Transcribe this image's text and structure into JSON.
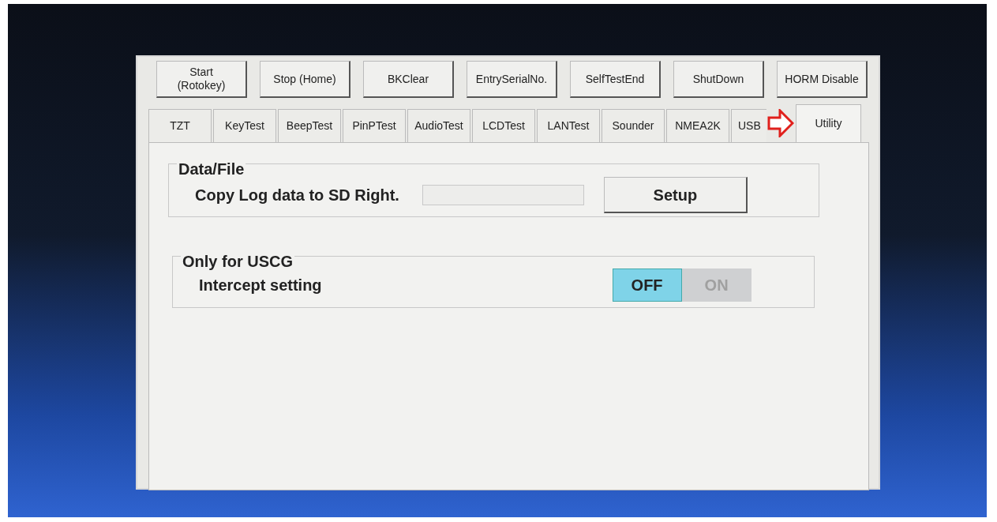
{
  "buttons": [
    "Start\n(Rotokey)",
    "Stop (Home)",
    "BKClear",
    "EntrySerialNo.",
    "SelfTestEnd",
    "ShutDown",
    "HORM Disable"
  ],
  "tabs": [
    {
      "label": "TZT",
      "selected": false
    },
    {
      "label": "KeyTest",
      "selected": false
    },
    {
      "label": "BeepTest",
      "selected": false
    },
    {
      "label": "PinPTest",
      "selected": false
    },
    {
      "label": "AudioTest",
      "selected": false
    },
    {
      "label": "LCDTest",
      "selected": false
    },
    {
      "label": "LANTest",
      "selected": false
    },
    {
      "label": "Sounder",
      "selected": false
    },
    {
      "label": "NMEA2K",
      "selected": false
    },
    {
      "label": "USB",
      "selected": false
    },
    {
      "label": "Utility",
      "selected": true
    }
  ],
  "groups": [
    {
      "title": "Data/File",
      "kind": "action",
      "label": "Copy Log data to SD Right.",
      "button": "Setup"
    },
    {
      "title": "Only for USCG",
      "kind": "toggle",
      "label": "Intercept setting",
      "options": [
        {
          "label": "OFF",
          "selected": true
        },
        {
          "label": "ON",
          "selected": false
        }
      ]
    }
  ]
}
